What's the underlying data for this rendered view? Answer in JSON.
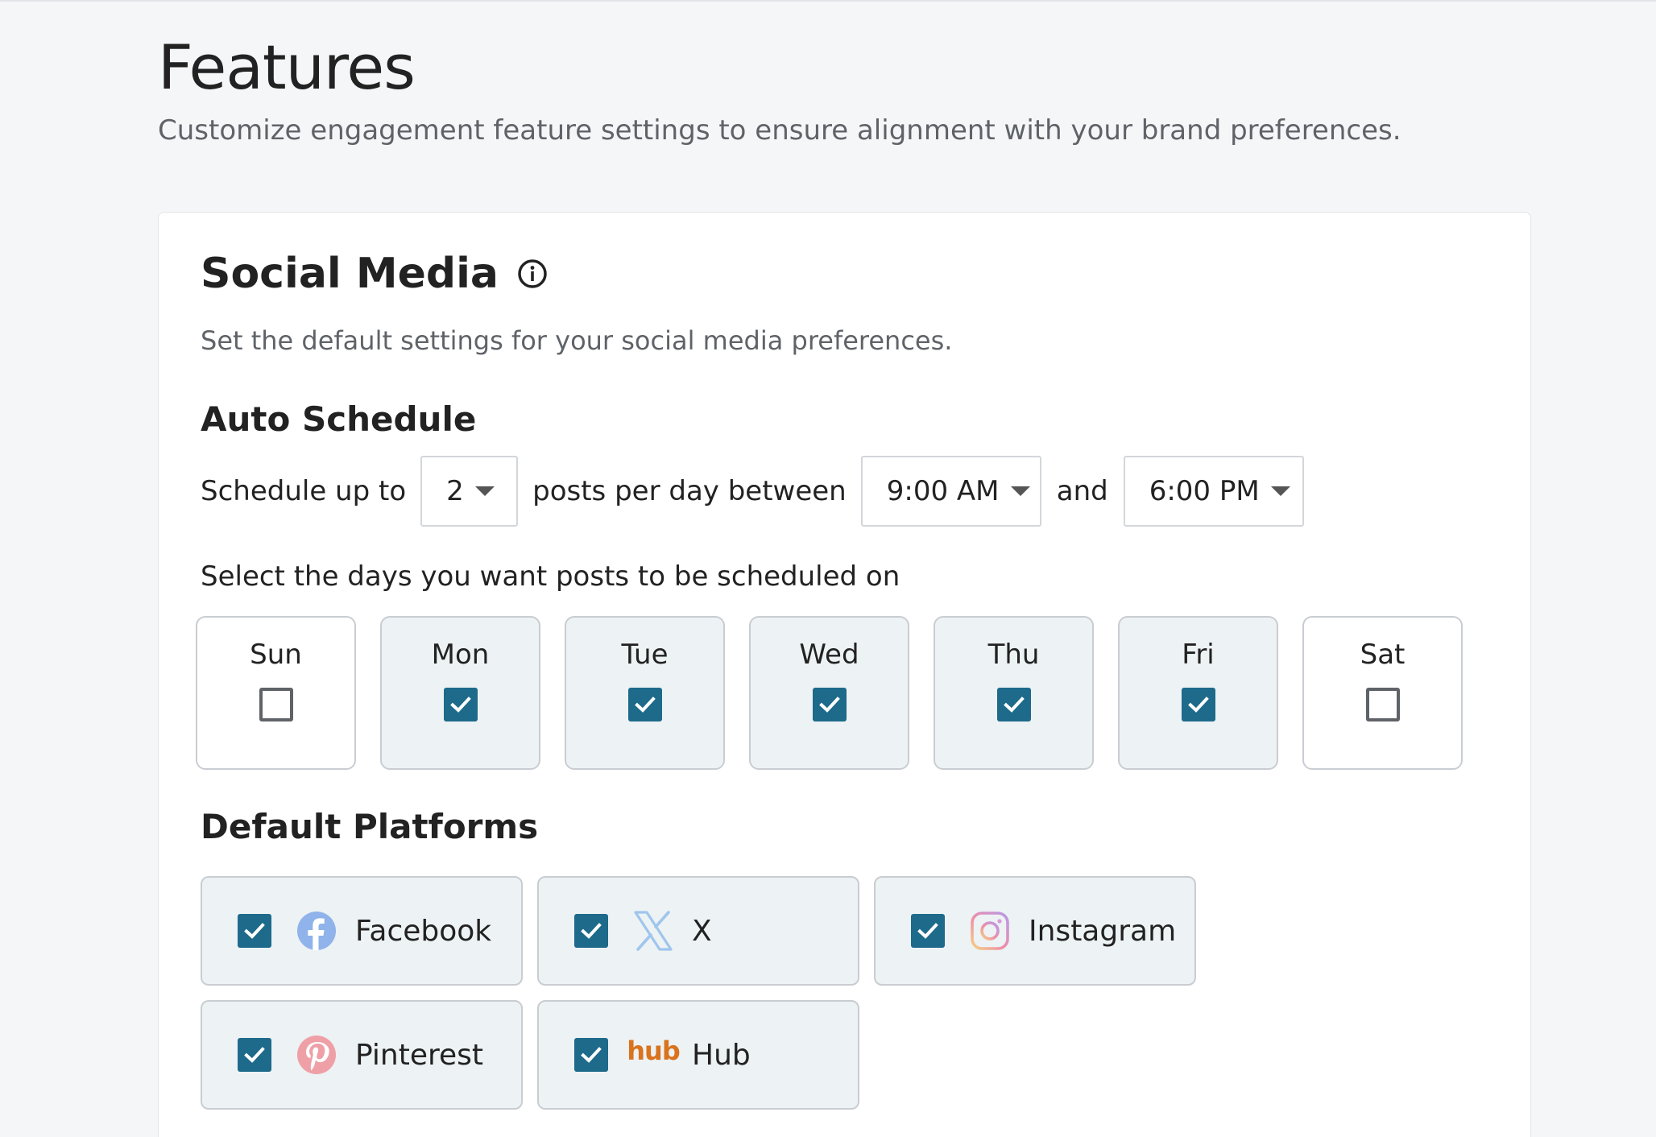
{
  "page": {
    "title": "Features",
    "subtitle": "Customize engagement feature settings to ensure alignment with your brand preferences."
  },
  "card": {
    "title": "Social Media",
    "info_icon": "info-circle-icon",
    "description": "Set the default settings for your social media preferences."
  },
  "auto_schedule": {
    "heading": "Auto Schedule",
    "text_prefix": "Schedule up to",
    "posts_value": "2",
    "text_middle": "posts per day between",
    "start_time": "9:00 AM",
    "text_and": "and",
    "end_time": "6:00 PM",
    "days_label": "Select the days you want posts to be scheduled on",
    "days": [
      {
        "label": "Sun",
        "checked": false
      },
      {
        "label": "Mon",
        "checked": true
      },
      {
        "label": "Tue",
        "checked": true
      },
      {
        "label": "Wed",
        "checked": true
      },
      {
        "label": "Thu",
        "checked": true
      },
      {
        "label": "Fri",
        "checked": true
      },
      {
        "label": "Sat",
        "checked": false
      }
    ]
  },
  "default_platforms": {
    "heading": "Default Platforms",
    "items": [
      {
        "label": "Facebook",
        "icon": "facebook-icon",
        "checked": true
      },
      {
        "label": "X",
        "icon": "x-icon",
        "checked": true
      },
      {
        "label": "Instagram",
        "icon": "instagram-icon",
        "checked": true
      },
      {
        "label": "Pinterest",
        "icon": "pinterest-icon",
        "checked": true
      },
      {
        "label": "Hub",
        "icon": "hub-icon",
        "logo_text": "hub",
        "checked": true
      }
    ]
  },
  "colors": {
    "accent": "#1d6a8a",
    "checked_tile_bg": "#edf2f4",
    "page_bg": "#f5f6f8",
    "hub_orange": "#d9731e"
  }
}
